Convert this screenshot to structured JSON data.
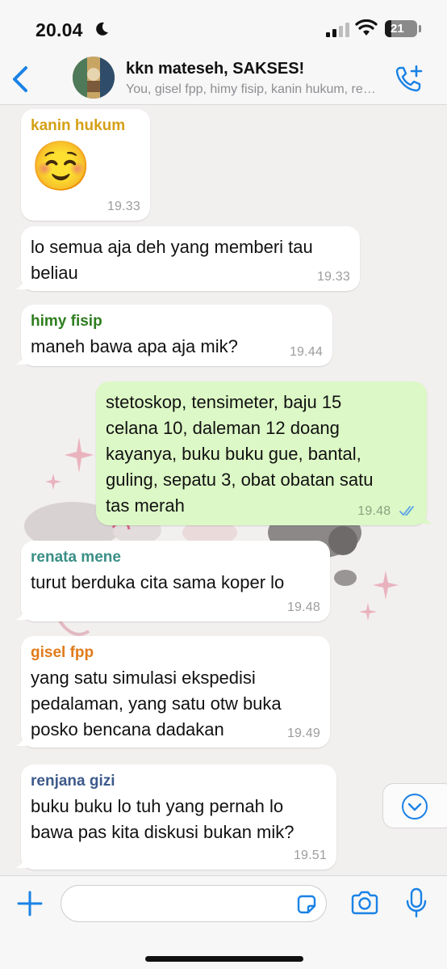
{
  "status_bar": {
    "time": "20.04",
    "battery": "21"
  },
  "header": {
    "group_name": "kkn mateseh, SAKSES!",
    "members": "You, gisel fpp, himy fisip, kanin hukum, renata mene, renjana gizi"
  },
  "messages": [
    {
      "sender": "kanin hukum",
      "sender_color": "#d4a017",
      "emoji": "☺️",
      "time": "19.33"
    },
    {
      "text": "lo semua aja deh yang memberi tau\nbeliau",
      "time": "19.33"
    },
    {
      "sender": "himy fisip",
      "sender_color": "#2e7d1f",
      "text": "maneh bawa apa aja mik?",
      "time": "19.44"
    },
    {
      "outgoing": true,
      "text": "stetoskop, tensimeter, baju 15\ncelana 10, daleman 12 doang\nkayanya, buku buku gue, bantal,\nguling, sepatu 3, obat obatan satu\ntas merah",
      "time": "19.48",
      "status": "read"
    },
    {
      "sender": "renata mene",
      "sender_color": "#3a8f86",
      "text": "turut berduka cita sama koper lo",
      "time": "19.48"
    },
    {
      "sender": "gisel fpp",
      "sender_color": "#e07b1a",
      "text": "yang satu simulasi ekspedisi\npedalaman, yang satu otw buka\nposko bencana dadakan",
      "time": "19.49"
    },
    {
      "sender": "renjana gizi",
      "sender_color": "#3d5a8c",
      "text": "buku buku lo tuh yang pernah lo\nbawa pas kita diskusi bukan mik?",
      "time": "19.51"
    }
  ],
  "input": {
    "value": "",
    "placeholder": ""
  },
  "colors": {
    "accent": "#1a82e6",
    "outgoing_bubble": "#dcf8c6",
    "incoming_bubble": "#ffffff",
    "read_ticks": "#5aa3e8"
  },
  "icons": [
    "moon-icon",
    "signal-icon",
    "wifi-icon",
    "battery-icon",
    "back-chevron-icon",
    "add-call-icon",
    "scroll-down-icon",
    "plus-icon",
    "sticker-icon",
    "camera-icon",
    "microphone-icon"
  ]
}
